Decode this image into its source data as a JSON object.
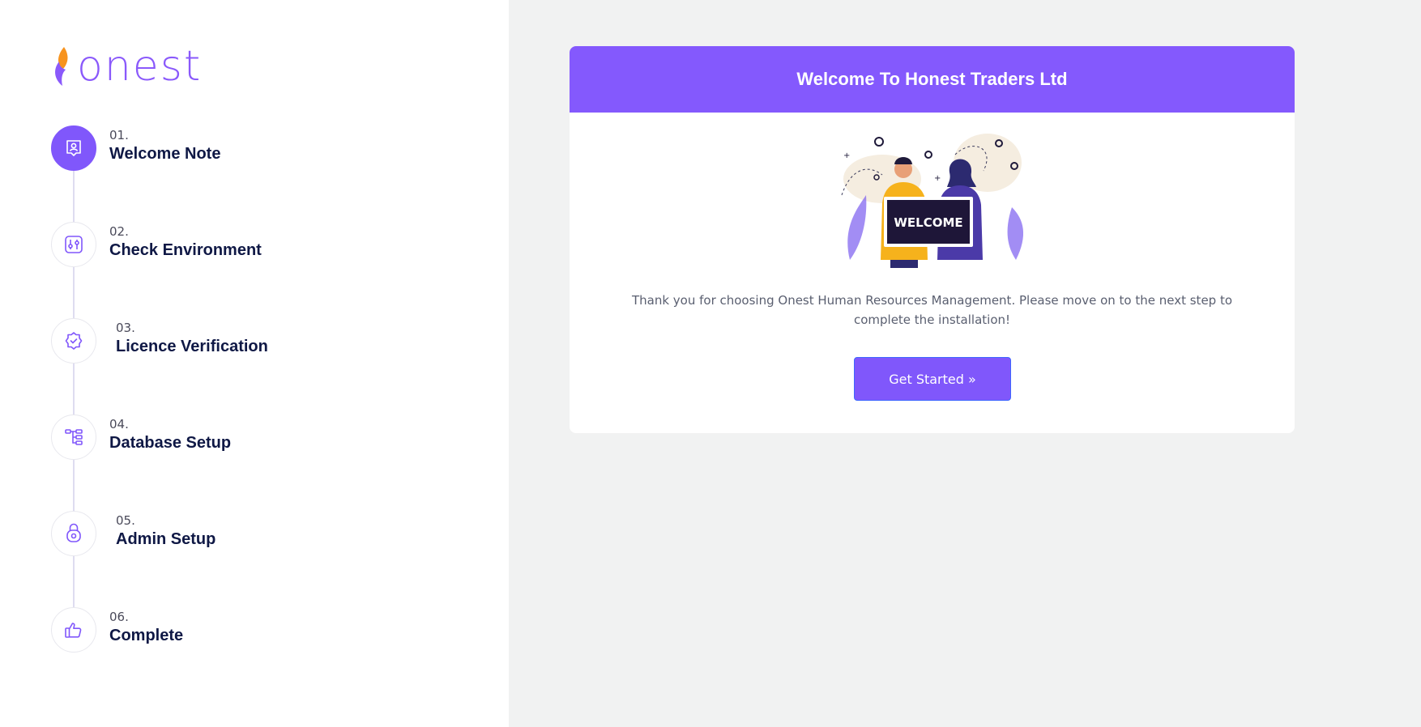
{
  "brand": {
    "logo_text": "onest",
    "accent": "#8057fb",
    "flame_colors": [
      "#f7931e",
      "#8a59fb"
    ]
  },
  "steps": [
    {
      "number": "01.",
      "title": "Welcome Note",
      "icon": "user-badge-icon",
      "active": true
    },
    {
      "number": "02.",
      "title": "Check Environment",
      "icon": "sliders-icon",
      "active": false
    },
    {
      "number": "03.",
      "title": "Licence Verification",
      "icon": "verified-badge-icon",
      "active": false
    },
    {
      "number": "04.",
      "title": "Database Setup",
      "icon": "hierarchy-icon",
      "active": false
    },
    {
      "number": "05.",
      "title": "Admin Setup",
      "icon": "lock-icon",
      "active": false
    },
    {
      "number": "06.",
      "title": "Complete",
      "icon": "thumbs-up-icon",
      "active": false
    }
  ],
  "card": {
    "title": "Welcome To Honest Traders Ltd",
    "illustration_sign": "WELCOME",
    "message": "Thank you for choosing Onest Human Resources Management. Please move on to the next step to complete the installation!",
    "button_label": "Get Started »"
  }
}
